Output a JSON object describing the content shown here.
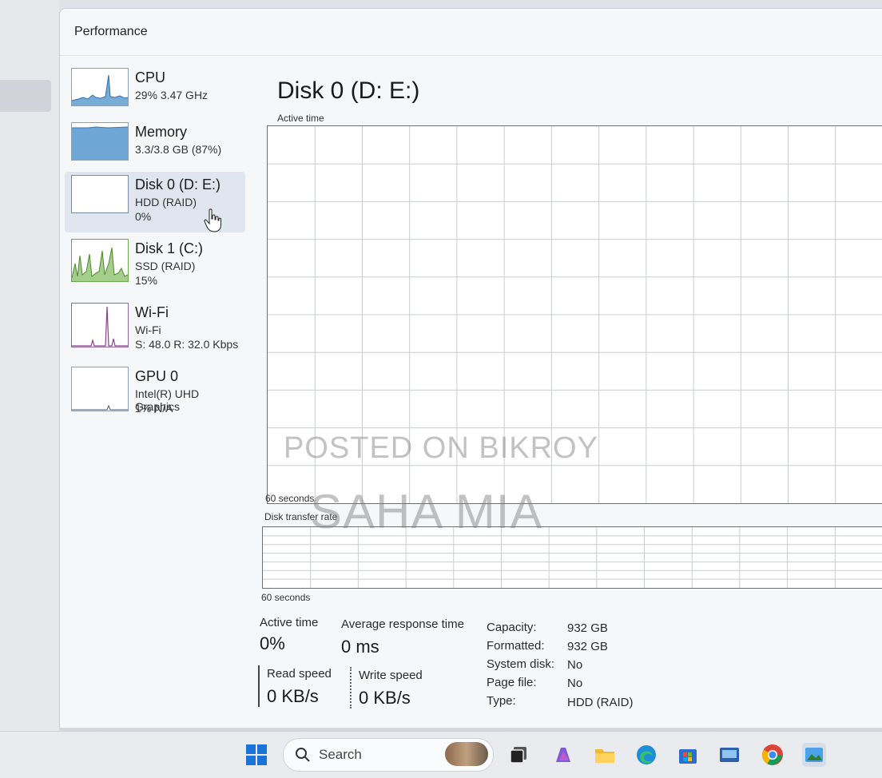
{
  "window": {
    "title": "Performance"
  },
  "sidebar": {
    "items": [
      {
        "name": "CPU",
        "sub": "29%  3.47 GHz",
        "sub2": ""
      },
      {
        "name": "Memory",
        "sub": "3.3/3.8 GB (87%)",
        "sub2": ""
      },
      {
        "name": "Disk 0 (D: E:)",
        "sub": "HDD (RAID)",
        "sub2": "0%"
      },
      {
        "name": "Disk 1 (C:)",
        "sub": "SSD (RAID)",
        "sub2": "15%"
      },
      {
        "name": "Wi-Fi",
        "sub": "Wi-Fi",
        "sub2": "S: 48.0  R: 32.0 Kbps"
      },
      {
        "name": "GPU 0",
        "sub": "Intel(R) UHD Graphics",
        "sub2": "1%  N/A"
      }
    ]
  },
  "main": {
    "title": "Disk 0 (D: E:)",
    "active_time_label": "Active time",
    "active_time_span": "60 seconds",
    "transfer_rate_label": "Disk transfer rate",
    "transfer_rate_span": "60 seconds",
    "stats": {
      "active_time_label": "Active time",
      "active_time_value": "0%",
      "avg_response_label": "Average response time",
      "avg_response_value": "0 ms",
      "read_speed_label": "Read speed",
      "read_speed_value": "0 KB/s",
      "write_speed_label": "Write speed",
      "write_speed_value": "0 KB/s"
    },
    "info": [
      {
        "key": "Capacity:",
        "value": "932 GB"
      },
      {
        "key": "Formatted:",
        "value": "932 GB"
      },
      {
        "key": "System disk:",
        "value": "No"
      },
      {
        "key": "Page file:",
        "value": "No"
      },
      {
        "key": "Type:",
        "value": "HDD (RAID)"
      }
    ]
  },
  "watermark": {
    "line1": "POSTED ON BIKROY",
    "line2": "SAHA MIA"
  },
  "taskbar": {
    "search_placeholder": "Search"
  },
  "colors": {
    "cpu_graph": "#4a90c8",
    "memory_graph": "#6ea6d6",
    "disk_graph": "#6aa84f",
    "wifi_graph": "#8e3f8e",
    "selected_bg": "#dfe6f0"
  }
}
